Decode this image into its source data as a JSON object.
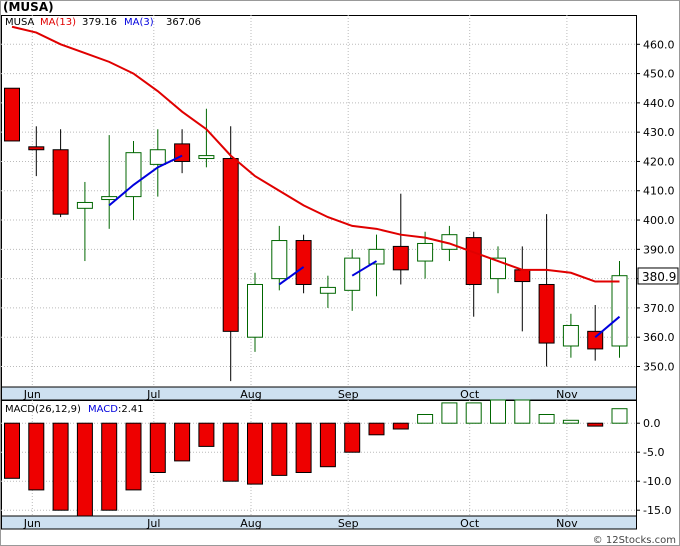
{
  "chart_data": [
    {
      "type": "candlestick",
      "title": "(MUSA)",
      "ticker_label": "MUSA",
      "legend": [
        {
          "name": "MA(13)",
          "value": "379.16",
          "color": "#e00000"
        },
        {
          "name": "MA(3)",
          "value": "367.06",
          "color": "#0000dd"
        }
      ],
      "last_price_label": "380.9",
      "ylim": [
        343,
        470
      ],
      "yticks": [
        350,
        360,
        370,
        380,
        390,
        400,
        410,
        420,
        430,
        440,
        450,
        460
      ],
      "ytick_labels": [
        "350.0",
        "360.0",
        "370.0",
        "380.0",
        "390.0",
        "400.0",
        "410.0",
        "420.0",
        "430.0",
        "440.0",
        "450.0",
        "460.0"
      ],
      "months": [
        {
          "label": "Jun",
          "index": 1.5
        },
        {
          "label": "Jul",
          "index": 6.5
        },
        {
          "label": "Aug",
          "index": 10.5
        },
        {
          "label": "Sep",
          "index": 14.5
        },
        {
          "label": "Oct",
          "index": 19.5
        },
        {
          "label": "Nov",
          "index": 23.5
        }
      ],
      "candles": [
        {
          "o": 445,
          "h": 445,
          "l": 427,
          "c": 427
        },
        {
          "o": 425,
          "h": 432,
          "l": 415,
          "c": 424
        },
        {
          "o": 424,
          "h": 431,
          "l": 401,
          "c": 402
        },
        {
          "o": 404,
          "h": 413,
          "l": 386,
          "c": 406
        },
        {
          "o": 407,
          "h": 429,
          "l": 397,
          "c": 408
        },
        {
          "o": 408,
          "h": 427,
          "l": 400,
          "c": 423
        },
        {
          "o": 419,
          "h": 431,
          "l": 408,
          "c": 424
        },
        {
          "o": 426,
          "h": 431,
          "l": 416,
          "c": 420
        },
        {
          "o": 421,
          "h": 438,
          "l": 418,
          "c": 422
        },
        {
          "o": 421,
          "h": 432,
          "l": 345,
          "c": 362
        },
        {
          "o": 360,
          "h": 382,
          "l": 355,
          "c": 378
        },
        {
          "o": 380,
          "h": 398,
          "l": 376,
          "c": 393
        },
        {
          "o": 393,
          "h": 395,
          "l": 375,
          "c": 378
        },
        {
          "o": 375,
          "h": 381,
          "l": 370,
          "c": 377
        },
        {
          "o": 376,
          "h": 390,
          "l": 369,
          "c": 387
        },
        {
          "o": 385,
          "h": 395,
          "l": 374,
          "c": 390
        },
        {
          "o": 391,
          "h": 409,
          "l": 378,
          "c": 383
        },
        {
          "o": 386,
          "h": 396,
          "l": 380,
          "c": 392
        },
        {
          "o": 390,
          "h": 398,
          "l": 386,
          "c": 395
        },
        {
          "o": 394,
          "h": 396,
          "l": 367,
          "c": 378
        },
        {
          "o": 380,
          "h": 391,
          "l": 375,
          "c": 387
        },
        {
          "o": 383,
          "h": 391,
          "l": 362,
          "c": 379
        },
        {
          "o": 378,
          "h": 402,
          "l": 350,
          "c": 358
        },
        {
          "o": 357,
          "h": 368,
          "l": 353,
          "c": 364
        },
        {
          "o": 362,
          "h": 371,
          "l": 352,
          "c": 356
        },
        {
          "o": 357,
          "h": 386,
          "l": 353,
          "c": 381
        }
      ],
      "ma13": [
        466,
        464,
        460,
        457,
        453,
        449,
        443,
        437,
        432,
        420,
        407,
        400,
        394,
        390,
        386,
        385,
        383,
        381,
        380,
        379,
        377,
        376,
        375,
        374,
        373,
        373
      ],
      "ma3": [
        null,
        null,
        null,
        null,
        null,
        null,
        null,
        null,
        null,
        null,
        null,
        null,
        null,
        null,
        null,
        null,
        null,
        null,
        null,
        null,
        null,
        null,
        null,
        null,
        null,
        null
      ],
      "ma3_blue": [
        [
          4,
          405
        ],
        [
          5,
          412
        ],
        [
          6,
          418
        ],
        [
          7,
          422
        ],
        [
          11,
          378
        ],
        [
          12,
          384
        ],
        [
          14,
          381
        ],
        [
          15,
          386
        ],
        [
          18,
          391
        ],
        [
          24,
          360
        ],
        [
          25,
          367
        ]
      ],
      "ma13_red": [
        [
          0,
          466
        ],
        [
          1,
          464
        ],
        [
          2,
          460
        ],
        [
          3,
          457
        ],
        [
          4,
          454
        ],
        [
          5,
          450
        ],
        [
          6,
          444
        ],
        [
          7,
          437
        ],
        [
          8,
          431
        ],
        [
          9,
          422
        ],
        [
          10,
          415
        ],
        [
          11,
          410
        ],
        [
          12,
          405
        ],
        [
          13,
          401
        ],
        [
          14,
          398
        ],
        [
          15,
          397
        ],
        [
          16,
          395
        ],
        [
          17,
          394
        ],
        [
          18,
          392
        ],
        [
          19,
          389
        ],
        [
          20,
          386
        ],
        [
          21,
          383
        ],
        [
          22,
          383
        ],
        [
          23,
          382
        ],
        [
          24,
          379
        ],
        [
          25,
          379
        ]
      ]
    },
    {
      "type": "bar",
      "title": "MACD(26,12,9)",
      "legend": [
        {
          "name": "MACD",
          "value": "2.41",
          "color": "#0000dd"
        }
      ],
      "ylim": [
        -16,
        4
      ],
      "yticks": [
        -15,
        -10,
        -5,
        0
      ],
      "ytick_labels": [
        "-15.0",
        "-10.0",
        "-5.0",
        "0.0"
      ],
      "values": [
        -9.5,
        -11.5,
        -15,
        -16,
        -15,
        -11.5,
        -8.5,
        -6.5,
        -4,
        -10,
        -10.5,
        -9,
        -8.5,
        -7.5,
        -5,
        -2,
        -1,
        1.5,
        3.5,
        3.5,
        4,
        4,
        1.5,
        0.5,
        -0.5,
        2.5
      ]
    }
  ],
  "watermark": "© 12Stocks.com"
}
